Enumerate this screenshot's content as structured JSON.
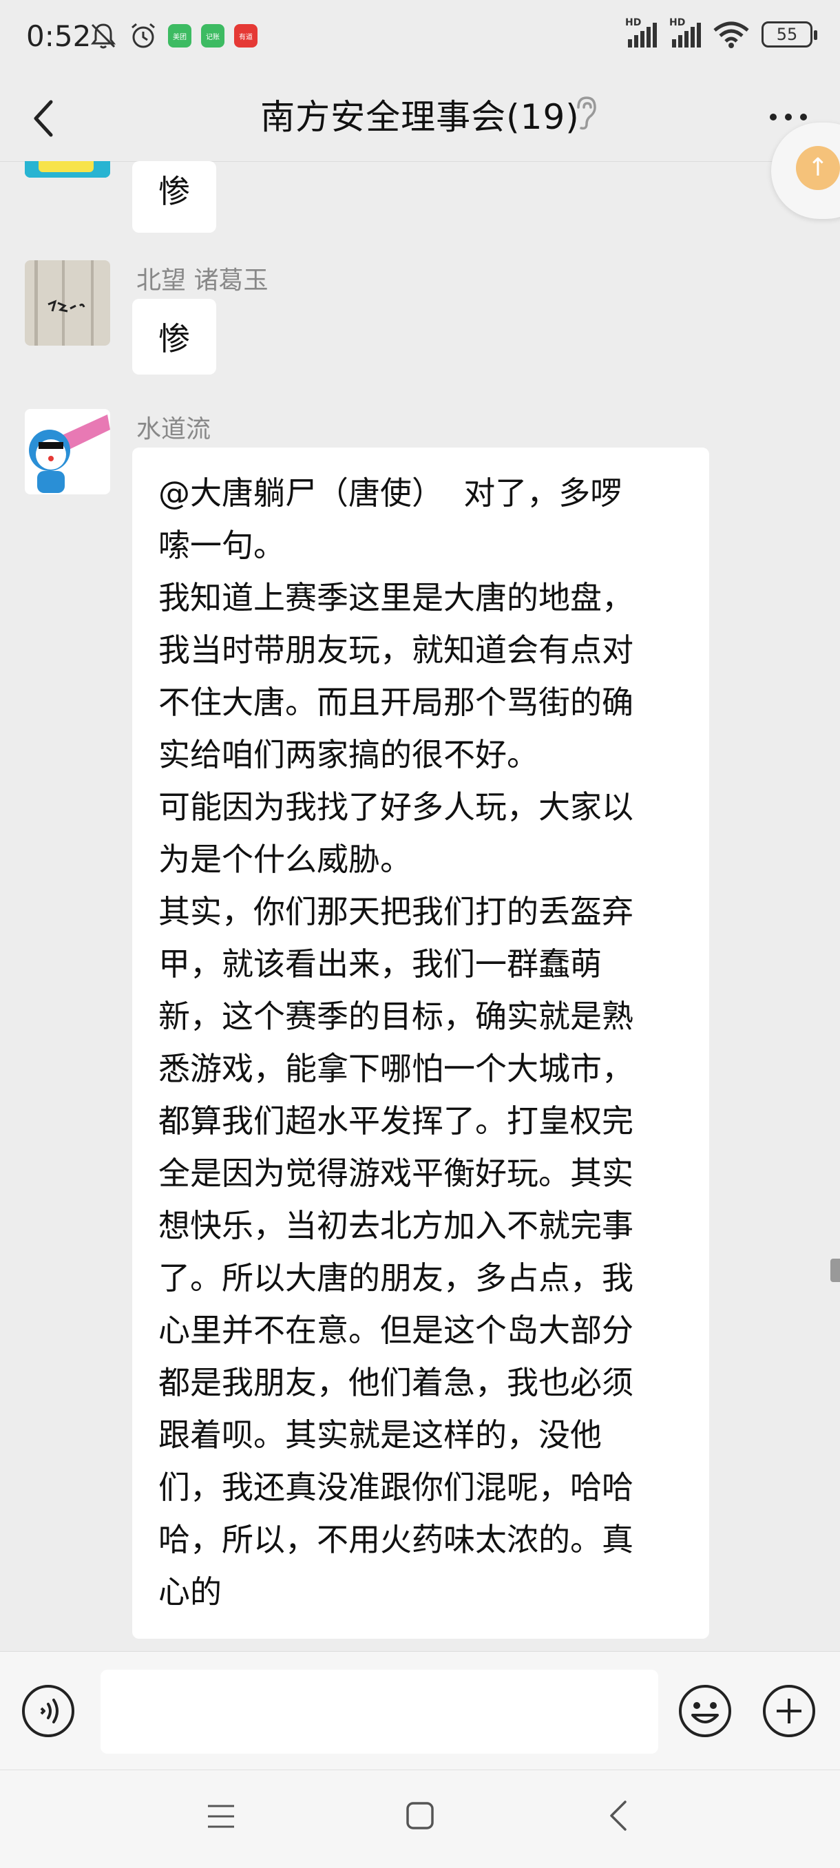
{
  "status_bar": {
    "time": "0:52",
    "battery": "55",
    "network_labels": [
      "HD",
      "HD"
    ],
    "app_badges": [
      {
        "label": "美团",
        "color": "#3dbb62"
      },
      {
        "label": "记账",
        "color": "#3dbb62"
      },
      {
        "label": "有道",
        "color": "#e53935"
      }
    ]
  },
  "header": {
    "title": "南方安全理事会(19)"
  },
  "messages": [
    {
      "sender": "",
      "text": "惨",
      "avatar": "spongebob-avatar"
    },
    {
      "sender": "北望 诸葛玉",
      "text": "惨",
      "avatar": "handwriting-avatar"
    },
    {
      "sender": "水道流",
      "avatar": "doraemon-avatar",
      "lines": [
        "@大唐躺尸（唐使）  对了，多啰",
        "嗦一句。",
        "我知道上赛季这里是大唐的地盘，",
        "我当时带朋友玩，就知道会有点对",
        "不住大唐。而且开局那个骂街的确",
        "实给咱们两家搞的很不好。",
        "可能因为我找了好多人玩，大家以",
        "为是个什么威胁。",
        "其实，你们那天把我们打的丢盔弃",
        "甲，就该看出来，我们一群蠢萌",
        "新，这个赛季的目标，确实就是熟",
        "悉游戏，能拿下哪怕一个大城市，",
        "都算我们超水平发挥了。打皇权完",
        "全是因为觉得游戏平衡好玩。其实",
        "想快乐，当初去北方加入不就完事",
        "了。所以大唐的朋友，多占点，我",
        "心里并不在意。但是这个岛大部分",
        "都是我朋友，他们着急，我也必须",
        "跟着呗。其实就是这样的，没他",
        "们，我还真没准跟你们混呢，哈哈",
        "哈，所以，不用火药味太浓的。真",
        "心的"
      ]
    }
  ],
  "input": {
    "value": "",
    "placeholder": ""
  },
  "colors": {
    "background": "#ededed",
    "bubble": "#ffffff",
    "sender_text": "#888888"
  }
}
